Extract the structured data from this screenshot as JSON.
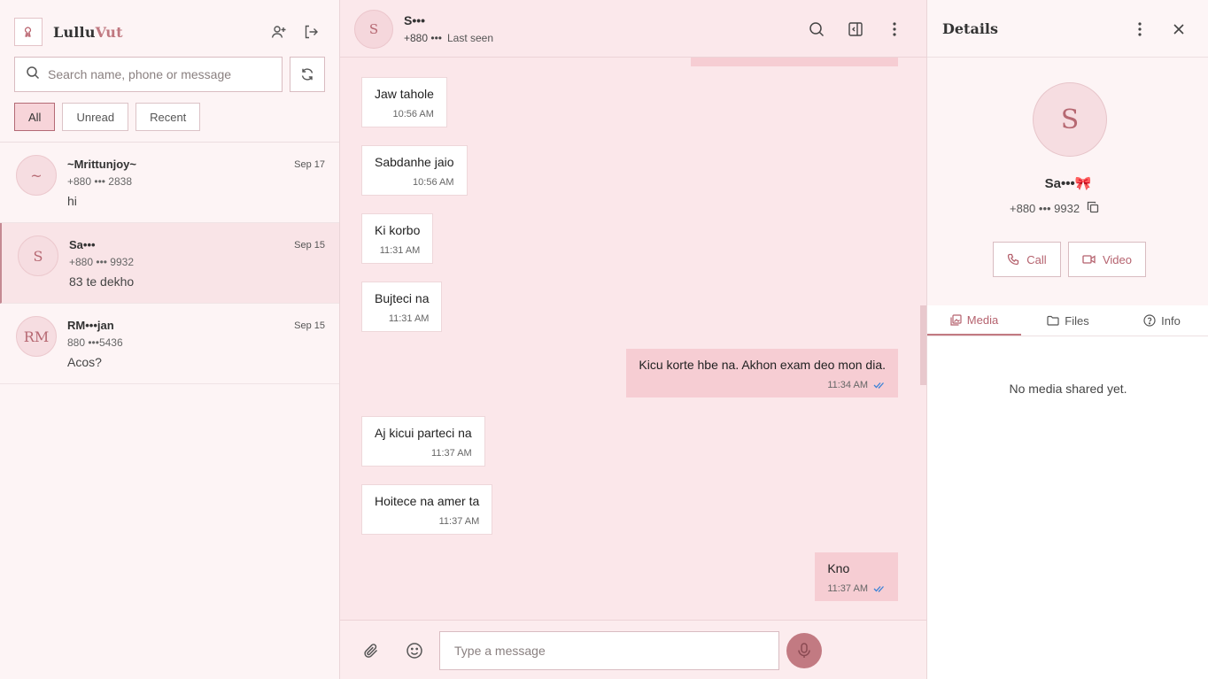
{
  "app": {
    "brand_main": "Lullu",
    "brand_accent": "Vut",
    "logo_icon": "flower-icon"
  },
  "sidebar": {
    "search_placeholder": "Search name, phone or message",
    "filters": [
      {
        "label": "All",
        "active": true
      },
      {
        "label": "Unread",
        "active": false
      },
      {
        "label": "Recent",
        "active": false
      }
    ],
    "chats": [
      {
        "initials": "~",
        "name": "~Mrittunjoy~",
        "phone": "+880 ••• 2838",
        "preview": "hi",
        "date": "Sep 17"
      },
      {
        "initials": "S",
        "name": "Sa•••",
        "phone": "+880 ••• 9932",
        "preview": "83 te dekho",
        "date": "Sep 15"
      },
      {
        "initials": "RM",
        "name": "RM•••jan",
        "phone": "880 •••5436",
        "preview": "Acos?",
        "date": "Sep 15"
      }
    ]
  },
  "conversation": {
    "avatar_initial": "S",
    "contact_name": "S•••",
    "contact_phone": "+880 •••",
    "last_seen": "Last seen",
    "messages": [
      {
        "dir": "in",
        "text": "Jaw tahole",
        "time": "10:56 AM"
      },
      {
        "dir": "in",
        "text": "Sabdanhe jaio",
        "time": "10:56 AM"
      },
      {
        "dir": "in",
        "text": "Ki korbo",
        "time": "11:31 AM"
      },
      {
        "dir": "in",
        "text": "Bujteci na",
        "time": "11:31 AM"
      },
      {
        "dir": "out",
        "text": "Kicu korte hbe na. Akhon exam deo mon dia.",
        "time": "11:34 AM"
      },
      {
        "dir": "in",
        "text": "Aj kicui parteci na",
        "time": "11:37 AM"
      },
      {
        "dir": "in",
        "text": "Hoitece na amer ta",
        "time": "11:37 AM"
      },
      {
        "dir": "out",
        "text": "Kno",
        "time": "11:37 AM"
      }
    ],
    "input_placeholder": "Type a message"
  },
  "details": {
    "title": "Details",
    "avatar_initial": "S",
    "name": "Sa•••🎀",
    "phone": "+880 ••• 9932",
    "call_label": "Call",
    "video_label": "Video",
    "tabs": [
      {
        "label": "Media",
        "icon": "image-icon",
        "active": true
      },
      {
        "label": "Files",
        "icon": "folder-icon",
        "active": false
      },
      {
        "label": "Info",
        "icon": "help-circle-icon",
        "active": false
      }
    ],
    "empty_text": "No media shared yet."
  },
  "colors": {
    "accent": "#c27a82",
    "accent_text": "#b5626e",
    "outgoing_bubble": "#f6cdd3",
    "conversation_bg": "#fbe7ea",
    "sidebar_bg": "#fdf4f5",
    "read_tick": "#3b82d6"
  }
}
